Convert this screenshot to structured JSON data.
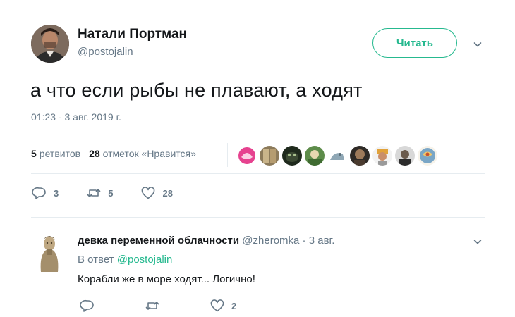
{
  "tweet": {
    "author_name": "Натали Портман",
    "author_handle": "@postojalin",
    "follow_label": "Читать",
    "text": "а что если рыбы не плавают, а ходят",
    "timestamp": "01:23 - 3 авг. 2019 г.",
    "retweets_count": "5",
    "retweets_label": "ретвитов",
    "likes_count": "28",
    "likes_label": "отметок «Нравится»",
    "actions": {
      "reply_count": "3",
      "retweet_count": "5",
      "like_count": "28"
    }
  },
  "reply": {
    "author_name": "девка переменной облачности",
    "author_handle": "@zheromka",
    "separator": " · ",
    "date": "3 авг.",
    "in_reply_label": "В ответ",
    "in_reply_handle": "@postojalin",
    "text": "Корабли же в море ходят... Логично!",
    "actions": {
      "like_count": "2"
    }
  },
  "colors": {
    "accent": "#26b98f",
    "muted": "#657786",
    "text": "#14171a",
    "divider": "#e6ecf0"
  },
  "icons": [
    "chevron-down-icon",
    "reply-icon",
    "retweet-icon",
    "like-icon"
  ]
}
